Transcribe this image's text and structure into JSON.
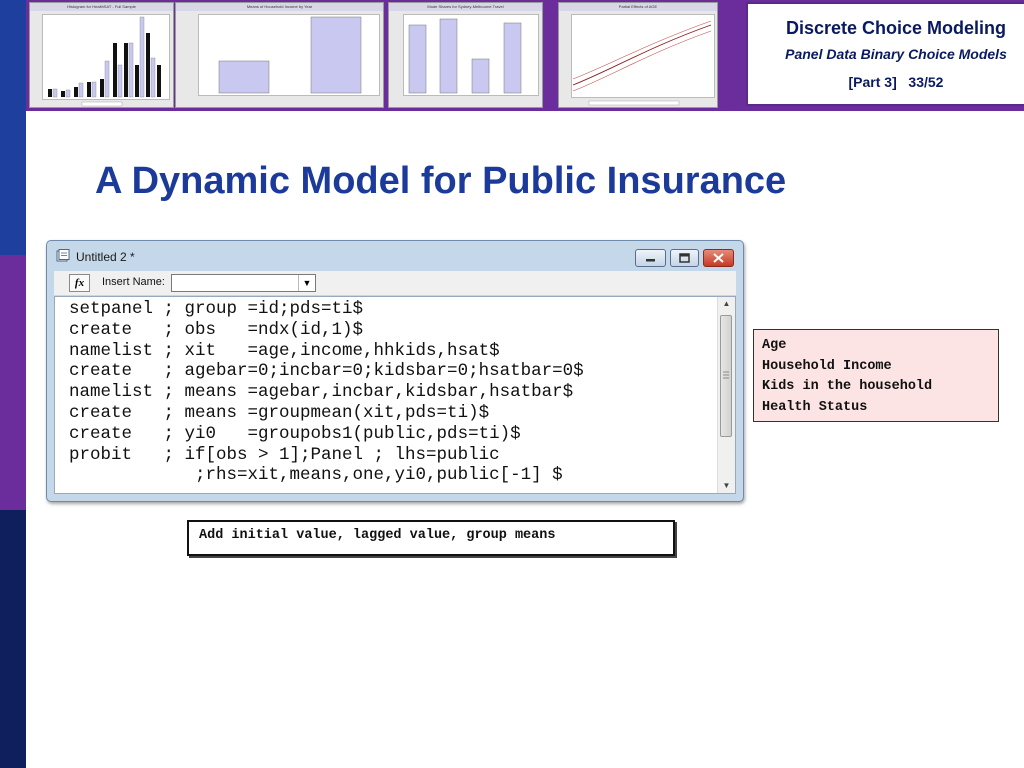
{
  "header": {
    "course_title": "Discrete Choice Modeling",
    "course_subtitle": "Panel Data Binary Choice Models",
    "part_label": "[Part 3]",
    "page_label": "33/52",
    "thumbnails": [
      {
        "label": "Histogram for HealthSAT - Full Sample"
      },
      {
        "label": "Means of Household Income by Year"
      },
      {
        "label": "Mode Shares for Sydney-Melbourne Travel"
      },
      {
        "label": "Partial Effects of AGE"
      }
    ]
  },
  "slide": {
    "title": "A Dynamic Model for Public Insurance"
  },
  "window": {
    "title": "Untitled 2 *",
    "insert_name_label": "Insert Name:",
    "insert_name_value": "",
    "fx_label": "fx",
    "code_lines": [
      "setpanel ; group =id;pds=ti$",
      "create   ; obs   =ndx(id,1)$",
      "namelist ; xit   =age,income,hhkids,hsat$",
      "create   ; agebar=0;incbar=0;kidsbar=0;hsatbar=0$",
      "namelist ; means =agebar,incbar,kidsbar,hsatbar$",
      "create   ; means =groupmean(xit,pds=ti)$",
      "create   ; yi0   =groupobs1(public,pds=ti)$",
      "probit   ; if[obs > 1];Panel ; lhs=public",
      "            ;rhs=xit,means,one,yi0,public[-1] $"
    ]
  },
  "notes": {
    "variables": [
      "Age",
      "Household Income",
      "Kids in the household",
      "Health Status"
    ],
    "caption": "Add initial value, lagged value, group means"
  },
  "colors": {
    "slide_title": "#1b3a9a",
    "left_bar_top": "#1f3f9f",
    "left_bar_mid": "#6a2d9b",
    "left_bar_bottom": "#0f1e5c",
    "note_bg": "#fde4e4"
  }
}
